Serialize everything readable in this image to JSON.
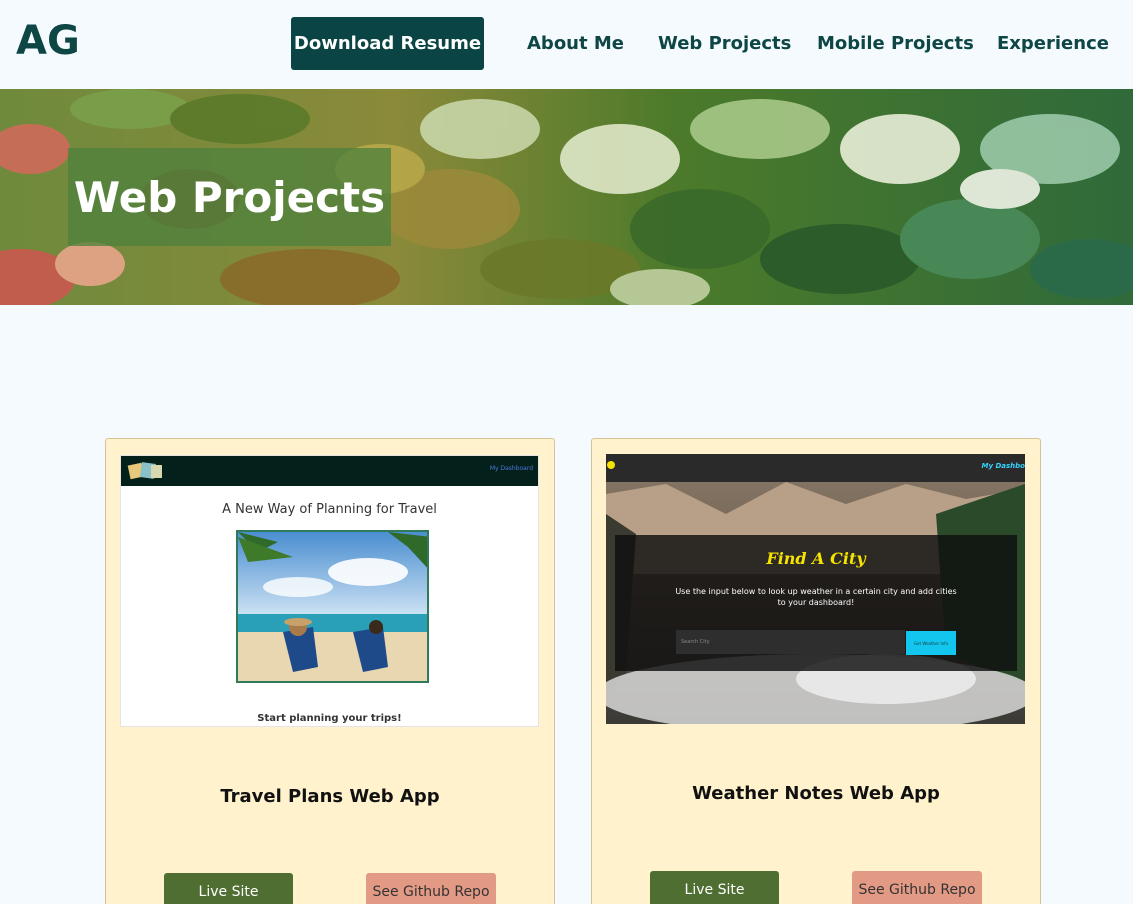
{
  "nav": {
    "logo": "AG",
    "download_label": "Download Resume",
    "links": [
      "About Me",
      "Web Projects",
      "Mobile Projects",
      "Experience"
    ]
  },
  "hero": {
    "title": "Web Projects"
  },
  "projects": [
    {
      "title": "Travel Plans Web App",
      "live_label": "Live Site",
      "repo_label": "See Github Repo",
      "preview": {
        "nav_link": "My Dashboard",
        "heading": "A New Way of Planning for Travel",
        "subheading": "Start planning your trips!"
      }
    },
    {
      "title": "Weather Notes Web App",
      "live_label": "Live Site",
      "repo_label": "See Github Repo",
      "preview": {
        "nav_link": "My Dashbo",
        "heading": "Find A City",
        "description": "Use the input below to look up weather in a certain city and add cities to your dashboard!",
        "input_placeholder": "Search City",
        "button_label": "Get Weather Info"
      }
    }
  ],
  "colors": {
    "brand": "#0e4545",
    "primary_button": "#0b4444",
    "live_button": "#4f6f32",
    "repo_button": "#e39a85",
    "card_bg": "#fff2cc",
    "page_bg": "#f4fafd"
  }
}
